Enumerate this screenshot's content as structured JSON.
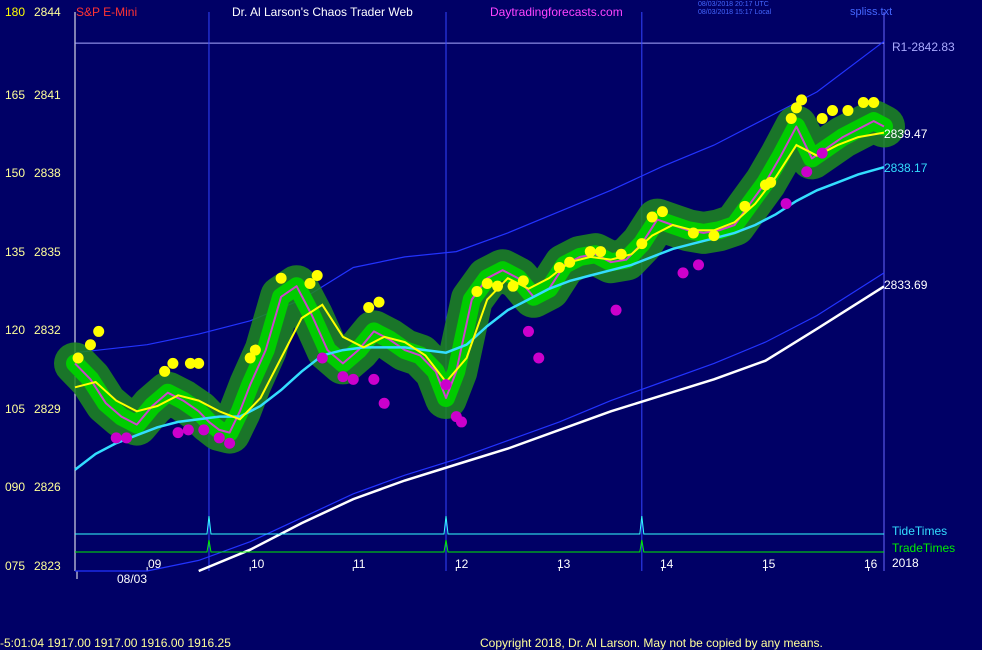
{
  "header": {
    "symbol": "S&P E-Mini",
    "site_title": "Dr. Al Larson's Chaos Trader Web",
    "site_url": "Daytradingforecasts.com",
    "utc_stamp": "08/03/2018 20:17 UTC",
    "local_stamp": "08/03/2018 15:17 Local",
    "file_name": "spliss.txt"
  },
  "footer": {
    "quote_line": "-5:01:04  1917.00 1917.00 1916.00 1916.25",
    "copyright": "Copyright 2018, Dr. Al Larson. May not be copied by any means."
  },
  "colors": {
    "background": "#000066",
    "price_green": "#00cc00",
    "highs_yellow": "#ffff00",
    "lows_magenta": "#cc00cc",
    "cyan_ma": "#33ddff",
    "white_ma": "#ffffff",
    "blue_channel": "#2233ff",
    "tide_times": "#33ffff",
    "trade_times": "#00ee00",
    "r1_line": "#aaaaff"
  },
  "chart_data": {
    "type": "line",
    "x_unit": "hour of day (08/03)",
    "y_left_scale": [
      "180",
      "165",
      "150",
      "135",
      "120",
      "105",
      "090",
      "075"
    ],
    "y_right_scale": [
      "2844",
      "2841",
      "2838",
      "2835",
      "2832",
      "2829",
      "2826",
      "2823"
    ],
    "y_range": [
      2823,
      2844
    ],
    "x_range": [
      8.3,
      16.15
    ],
    "x_ticks": [
      "09",
      "10",
      "11",
      "12",
      "13",
      "14",
      "15",
      "16"
    ],
    "date_label": "08/03",
    "year_label": "2018",
    "r1_level": {
      "label": "R1-2842.83",
      "value": 2842.83
    },
    "end_labels": {
      "price": "2839.47",
      "cyan": "2838.17",
      "white": "2833.69"
    },
    "tide_times_label": "TideTimes",
    "trade_times_label": "TradeTimes",
    "vertical_markers": [
      9.6,
      11.9,
      13.8
    ],
    "series": [
      {
        "key": "price",
        "type": "area",
        "x": [
          8.3,
          8.45,
          8.6,
          8.75,
          8.9,
          9.05,
          9.2,
          9.35,
          9.5,
          9.6,
          9.7,
          9.8,
          9.9,
          10.0,
          10.15,
          10.3,
          10.45,
          10.6,
          10.75,
          10.9,
          11.05,
          11.2,
          11.35,
          11.5,
          11.65,
          11.8,
          11.9,
          12.0,
          12.15,
          12.3,
          12.45,
          12.6,
          12.75,
          12.9,
          13.05,
          13.2,
          13.35,
          13.5,
          13.65,
          13.8,
          13.95,
          14.1,
          14.25,
          14.4,
          14.55,
          14.7,
          14.85,
          15.0,
          15.15,
          15.3,
          15.45,
          15.6,
          15.75,
          15.9,
          16.05,
          16.15
        ],
        "values": [
          2830.8,
          2830.2,
          2829.3,
          2828.8,
          2828.5,
          2829.2,
          2829.7,
          2829.4,
          2829.0,
          2828.6,
          2828.3,
          2828.2,
          2829.0,
          2830.0,
          2831.3,
          2833.3,
          2833.7,
          2832.6,
          2831.3,
          2830.8,
          2831.3,
          2832.0,
          2831.7,
          2831.3,
          2831.1,
          2830.5,
          2829.5,
          2830.5,
          2833.2,
          2834.0,
          2834.3,
          2834.0,
          2833.3,
          2833.6,
          2834.5,
          2834.8,
          2834.9,
          2834.6,
          2834.7,
          2835.3,
          2836.2,
          2836.0,
          2835.8,
          2835.7,
          2835.8,
          2836.0,
          2836.8,
          2837.6,
          2838.6,
          2839.7,
          2838.5,
          2838.9,
          2839.3,
          2839.6,
          2839.9,
          2839.7
        ]
      },
      {
        "key": "fast_ma",
        "x": [
          8.3,
          8.5,
          8.7,
          8.9,
          9.1,
          9.3,
          9.5,
          9.7,
          9.9,
          10.1,
          10.3,
          10.5,
          10.7,
          10.9,
          11.1,
          11.3,
          11.5,
          11.7,
          11.9,
          12.1,
          12.3,
          12.5,
          12.7,
          12.9,
          13.1,
          13.3,
          13.5,
          13.7,
          13.9,
          14.1,
          14.3,
          14.5,
          14.7,
          14.9,
          15.1,
          15.3,
          15.5,
          15.7,
          15.9,
          16.15
        ],
        "values": [
          2829.9,
          2830.1,
          2829.4,
          2829.0,
          2829.2,
          2829.6,
          2829.4,
          2829.0,
          2828.7,
          2829.5,
          2831.0,
          2832.5,
          2833.0,
          2831.8,
          2831.4,
          2831.8,
          2831.6,
          2831.1,
          2830.1,
          2831.0,
          2833.2,
          2834.0,
          2833.6,
          2834.0,
          2834.6,
          2834.8,
          2834.7,
          2834.9,
          2835.6,
          2836.0,
          2835.8,
          2835.8,
          2836.1,
          2836.8,
          2837.8,
          2839.0,
          2838.6,
          2839.0,
          2839.3,
          2839.47
        ]
      },
      {
        "key": "cyan_ma",
        "x": [
          8.3,
          8.5,
          8.7,
          8.9,
          9.1,
          9.3,
          9.5,
          9.7,
          9.9,
          10.1,
          10.3,
          10.5,
          10.7,
          10.9,
          11.1,
          11.3,
          11.5,
          11.7,
          11.9,
          12.1,
          12.3,
          12.5,
          12.7,
          12.9,
          13.1,
          13.3,
          13.5,
          13.7,
          13.9,
          14.1,
          14.3,
          14.5,
          14.7,
          14.9,
          15.1,
          15.3,
          15.5,
          15.7,
          15.9,
          16.15
        ],
        "values": [
          2826.8,
          2827.4,
          2827.8,
          2828.1,
          2828.4,
          2828.6,
          2828.7,
          2828.8,
          2828.8,
          2829.2,
          2829.8,
          2830.5,
          2831.1,
          2831.3,
          2831.4,
          2831.4,
          2831.4,
          2831.3,
          2831.2,
          2831.5,
          2832.2,
          2832.8,
          2833.2,
          2833.6,
          2833.9,
          2834.1,
          2834.3,
          2834.5,
          2834.8,
          2835.1,
          2835.3,
          2835.5,
          2835.7,
          2836.0,
          2836.4,
          2836.9,
          2837.3,
          2837.6,
          2837.9,
          2838.17
        ]
      },
      {
        "key": "white_ma",
        "x": [
          9.5,
          10.0,
          10.5,
          11.0,
          11.5,
          12.0,
          12.5,
          13.0,
          13.5,
          14.0,
          14.5,
          15.0,
          15.5,
          16.15
        ],
        "values": [
          2823.0,
          2823.8,
          2824.8,
          2825.7,
          2826.4,
          2827.0,
          2827.6,
          2828.3,
          2829.0,
          2829.6,
          2830.2,
          2830.9,
          2832.1,
          2833.69
        ]
      },
      {
        "key": "channel_upper",
        "x": [
          8.3,
          9.0,
          9.5,
          10.0,
          10.5,
          11.0,
          11.5,
          12.0,
          12.5,
          13.0,
          13.5,
          14.0,
          14.5,
          15.0,
          15.5,
          16.15
        ],
        "values": [
          2831.2,
          2831.5,
          2831.9,
          2832.4,
          2833.2,
          2834.4,
          2834.8,
          2835.0,
          2835.7,
          2836.5,
          2837.3,
          2838.2,
          2839.0,
          2840.0,
          2841.0,
          2842.9
        ]
      },
      {
        "key": "channel_lower",
        "x": [
          8.3,
          9.0,
          9.5,
          10.0,
          10.5,
          11.0,
          11.5,
          12.0,
          12.5,
          13.0,
          13.5,
          14.0,
          14.5,
          15.0,
          15.5,
          16.15
        ],
        "values": [
          2823.0,
          2823.0,
          2823.4,
          2824.1,
          2825.0,
          2825.9,
          2826.6,
          2827.2,
          2827.9,
          2828.6,
          2829.4,
          2830.1,
          2830.8,
          2831.6,
          2832.6,
          2834.2
        ]
      }
    ],
    "highs_dots": [
      [
        8.33,
        2831.0
      ],
      [
        8.45,
        2831.5
      ],
      [
        8.53,
        2832.0
      ],
      [
        9.17,
        2830.5
      ],
      [
        9.25,
        2830.8
      ],
      [
        9.42,
        2830.8
      ],
      [
        9.5,
        2830.8
      ],
      [
        10.0,
        2831.0
      ],
      [
        10.05,
        2831.3
      ],
      [
        10.3,
        2834.0
      ],
      [
        10.58,
        2833.8
      ],
      [
        10.65,
        2834.1
      ],
      [
        11.15,
        2832.9
      ],
      [
        11.25,
        2833.1
      ],
      [
        12.2,
        2833.5
      ],
      [
        12.3,
        2833.8
      ],
      [
        12.4,
        2833.7
      ],
      [
        12.55,
        2833.7
      ],
      [
        12.65,
        2833.9
      ],
      [
        13.0,
        2834.4
      ],
      [
        13.1,
        2834.6
      ],
      [
        13.3,
        2835.0
      ],
      [
        13.4,
        2835.0
      ],
      [
        13.6,
        2834.9
      ],
      [
        13.8,
        2835.3
      ],
      [
        13.9,
        2836.3
      ],
      [
        14.0,
        2836.5
      ],
      [
        14.3,
        2835.7
      ],
      [
        14.5,
        2835.6
      ],
      [
        14.8,
        2836.7
      ],
      [
        15.0,
        2837.5
      ],
      [
        15.05,
        2837.6
      ],
      [
        15.25,
        2840.0
      ],
      [
        15.3,
        2840.4
      ],
      [
        15.35,
        2840.7
      ],
      [
        15.55,
        2840.0
      ],
      [
        15.65,
        2840.3
      ],
      [
        15.8,
        2840.3
      ],
      [
        15.95,
        2840.6
      ],
      [
        16.05,
        2840.6
      ]
    ],
    "lows_dots": [
      [
        8.7,
        2828.0
      ],
      [
        8.8,
        2828.0
      ],
      [
        9.3,
        2828.2
      ],
      [
        9.4,
        2828.3
      ],
      [
        9.55,
        2828.3
      ],
      [
        9.7,
        2828.0
      ],
      [
        9.8,
        2827.8
      ],
      [
        10.7,
        2831.0
      ],
      [
        10.9,
        2830.3
      ],
      [
        11.0,
        2830.2
      ],
      [
        11.2,
        2830.2
      ],
      [
        11.3,
        2829.3
      ],
      [
        11.9,
        2830.0
      ],
      [
        12.0,
        2828.8
      ],
      [
        12.05,
        2828.6
      ],
      [
        12.7,
        2832.0
      ],
      [
        12.8,
        2831.0
      ],
      [
        13.55,
        2832.8
      ],
      [
        14.2,
        2834.2
      ],
      [
        14.35,
        2834.5
      ],
      [
        15.2,
        2836.8
      ],
      [
        15.4,
        2838.0
      ],
      [
        15.55,
        2838.7
      ]
    ]
  }
}
